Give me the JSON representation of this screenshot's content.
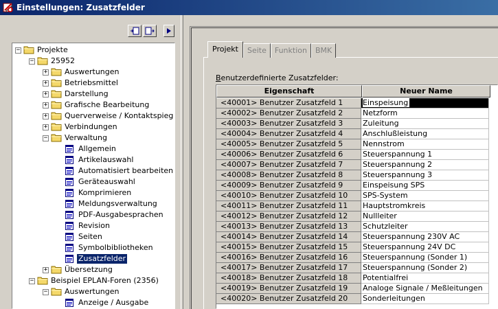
{
  "window": {
    "title": "Einstellungen: Zusatzfelder"
  },
  "left_toolbar": {
    "icons": [
      "expand-icon",
      "collapse-icon",
      "arrow-right-icon"
    ]
  },
  "tree": [
    {
      "label": "Projekte",
      "level": 0,
      "icon": "folder",
      "expander": "-"
    },
    {
      "label": "25952",
      "level": 1,
      "icon": "folder",
      "expander": "-"
    },
    {
      "label": "Auswertungen",
      "level": 2,
      "icon": "folder",
      "expander": "+"
    },
    {
      "label": "Betriebsmittel",
      "level": 2,
      "icon": "folder",
      "expander": "+"
    },
    {
      "label": "Darstellung",
      "level": 2,
      "icon": "folder",
      "expander": "+"
    },
    {
      "label": "Grafische Bearbeitung",
      "level": 2,
      "icon": "folder",
      "expander": "+"
    },
    {
      "label": "Querverweise / Kontaktspieg",
      "level": 2,
      "icon": "folder",
      "expander": "+"
    },
    {
      "label": "Verbindungen",
      "level": 2,
      "icon": "folder",
      "expander": "+"
    },
    {
      "label": "Verwaltung",
      "level": 2,
      "icon": "folder",
      "expander": "-"
    },
    {
      "label": "Allgemein",
      "level": 3,
      "icon": "page"
    },
    {
      "label": "Artikelauswahl",
      "level": 3,
      "icon": "page"
    },
    {
      "label": "Automatisiert bearbeiten",
      "level": 3,
      "icon": "page"
    },
    {
      "label": "Geräteauswahl",
      "level": 3,
      "icon": "page"
    },
    {
      "label": "Komprimieren",
      "level": 3,
      "icon": "page"
    },
    {
      "label": "Meldungsverwaltung",
      "level": 3,
      "icon": "page"
    },
    {
      "label": "PDF-Ausgabesprachen",
      "level": 3,
      "icon": "page"
    },
    {
      "label": "Revision",
      "level": 3,
      "icon": "page"
    },
    {
      "label": "Seiten",
      "level": 3,
      "icon": "page"
    },
    {
      "label": "Symbolbibliotheken",
      "level": 3,
      "icon": "page"
    },
    {
      "label": "Zusatzfelder",
      "level": 3,
      "icon": "page",
      "selected": true
    },
    {
      "label": "Übersetzung",
      "level": 2,
      "icon": "folder",
      "expander": "+"
    },
    {
      "label": "Beispiel EPLAN-Foren (2356)",
      "level": 1,
      "icon": "folder",
      "expander": "-"
    },
    {
      "label": "Auswertungen",
      "level": 2,
      "icon": "folder",
      "expander": "-"
    },
    {
      "label": "Anzeige / Ausgabe",
      "level": 3,
      "icon": "page"
    }
  ],
  "tabs": [
    {
      "label": "Projekt",
      "active": true
    },
    {
      "label": "Seite",
      "active": false
    },
    {
      "label": "Funktion",
      "active": false
    },
    {
      "label": "BMK",
      "active": false
    }
  ],
  "grid": {
    "caption_underlined": "B",
    "caption_rest": "enutzerdefinierte Zusatzfelder:",
    "headers": [
      "Eigenschaft",
      "Neuer Name"
    ],
    "rows": [
      {
        "property": "<40001> Benutzer Zusatzfeld 1",
        "name": "Einspeisung",
        "selected": true
      },
      {
        "property": "<40002> Benutzer Zusatzfeld 2",
        "name": "Netzform"
      },
      {
        "property": "<40003> Benutzer Zusatzfeld 3",
        "name": "Zuleitung"
      },
      {
        "property": "<40004> Benutzer Zusatzfeld 4",
        "name": "Anschlußleistung"
      },
      {
        "property": "<40005> Benutzer Zusatzfeld 5",
        "name": "Nennstrom"
      },
      {
        "property": "<40006> Benutzer Zusatzfeld 6",
        "name": "Steuerspannung 1"
      },
      {
        "property": "<40007> Benutzer Zusatzfeld 7",
        "name": "Steuerspannung 2"
      },
      {
        "property": "<40008> Benutzer Zusatzfeld 8",
        "name": "Steuerspannung 3"
      },
      {
        "property": "<40009> Benutzer Zusatzfeld 9",
        "name": "Einspeisung SPS"
      },
      {
        "property": "<40010> Benutzer Zusatzfeld 10",
        "name": "SPS-System"
      },
      {
        "property": "<40011> Benutzer Zusatzfeld 11",
        "name": "Hauptstromkreis"
      },
      {
        "property": "<40012> Benutzer Zusatzfeld 12",
        "name": "Nullleiter"
      },
      {
        "property": "<40013> Benutzer Zusatzfeld 13",
        "name": "Schutzleiter"
      },
      {
        "property": "<40014> Benutzer Zusatzfeld 14",
        "name": "Steuerspannung 230V AC"
      },
      {
        "property": "<40015> Benutzer Zusatzfeld 15",
        "name": "Steuerspannung 24V DC"
      },
      {
        "property": "<40016> Benutzer Zusatzfeld 16",
        "name": "Steuerspannung (Sonder 1)"
      },
      {
        "property": "<40017> Benutzer Zusatzfeld 17",
        "name": "Steuerspannung (Sonder 2)"
      },
      {
        "property": "<40018> Benutzer Zusatzfeld 18",
        "name": "Potentialfrei"
      },
      {
        "property": "<40019> Benutzer Zusatzfeld 19",
        "name": "Analoge Signale / Meßleitungen"
      },
      {
        "property": "<40020> Benutzer Zusatzfeld 20",
        "name": "Sonderleitungen"
      }
    ]
  },
  "colors": {
    "title_bar": "#0a246a",
    "selection": "#0a246a",
    "face": "#d4d0c8",
    "folder": "#f4d86a"
  }
}
